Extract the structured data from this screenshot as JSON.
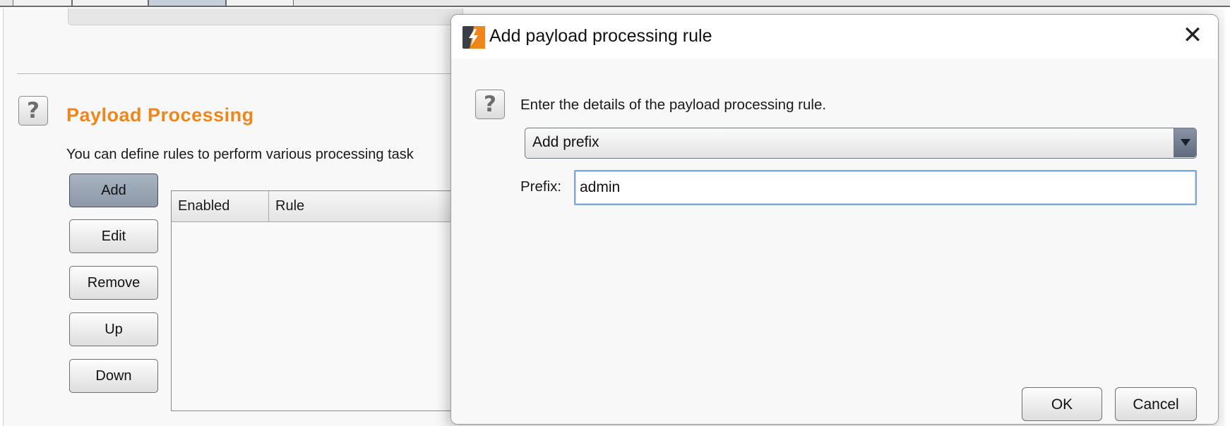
{
  "background_panel": {
    "section_title": "Payload Processing",
    "section_description": "You can define rules to perform various processing task",
    "buttons": {
      "add": "Add",
      "edit": "Edit",
      "remove": "Remove",
      "up": "Up",
      "down": "Down"
    },
    "table": {
      "columns": [
        "Enabled",
        "Rule"
      ],
      "rows": []
    },
    "help_glyph": "?"
  },
  "dialog": {
    "title": "Add payload processing rule",
    "close_glyph": "✕",
    "help_glyph": "?",
    "description": "Enter the details of the payload processing rule.",
    "rule_type": {
      "selected": "Add prefix"
    },
    "prefix_field": {
      "label": "Prefix:",
      "value": "admin"
    },
    "buttons": {
      "ok": "OK",
      "cancel": "Cancel"
    }
  },
  "colors": {
    "accent_orange": "#f0861a",
    "logo_dark": "#3a3f47",
    "focus_border": "#7ea6d4"
  },
  "icons": {
    "app_logo": "burp-lightning-logo-icon",
    "help": "question-mark-icon",
    "close": "close-icon",
    "dropdown": "chevron-down-icon"
  }
}
